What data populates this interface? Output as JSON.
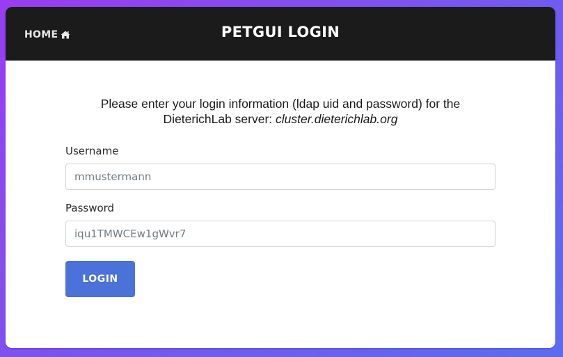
{
  "header": {
    "home_label": "HOME",
    "home_icon": "home-icon",
    "title": "PETGUI LOGIN"
  },
  "intro": {
    "text_prefix": "Please enter your login information (ldap uid and password) for the DieterichLab server: ",
    "server": "cluster.dieterichlab.org"
  },
  "form": {
    "username_label": "Username",
    "username_placeholder": "mmustermann",
    "password_label": "Password",
    "password_placeholder": "iqu1TMWCEw1gWvr7",
    "login_button": "LOGIN"
  },
  "colors": {
    "header_bg": "#1c1b1b",
    "button_bg": "#4a72d8",
    "background_gradient_start": "#9a3cf2",
    "background_gradient_end": "#5b6cf0"
  }
}
